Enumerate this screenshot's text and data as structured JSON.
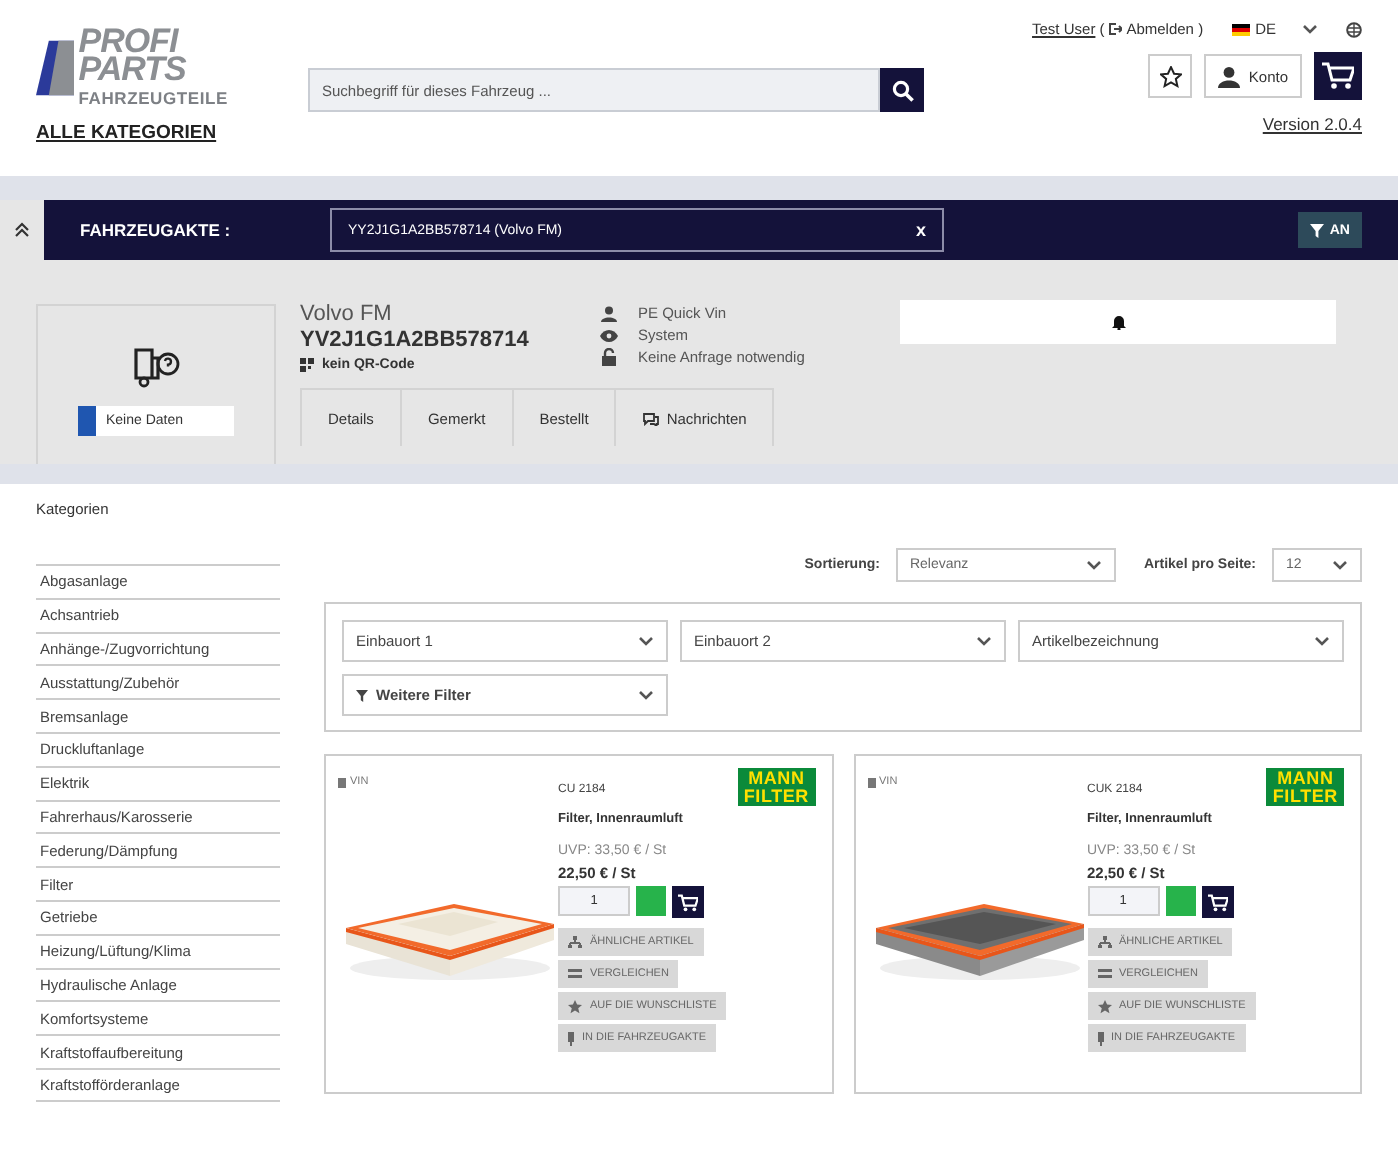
{
  "header": {
    "logo": {
      "line1": "PROFI",
      "line2": "PARTS",
      "tagline": "FAHRZEUGTEILE"
    },
    "all_categories": "ALLE KATEGORIEN",
    "search": {
      "placeholder": "Suchbegriff für dieses Fahrzeug ..."
    },
    "user": "Test User",
    "logout": {
      "open": "(",
      "label": "Abmelden",
      "close": ")"
    },
    "language": "DE",
    "account": "Konto",
    "version": "Version 2.0.4"
  },
  "vehicle_bar": {
    "label": "FAHRZEUGAKTE :",
    "value": "YY2J1G1A2BB578714 (Volvo FM)",
    "clear": "x",
    "filter_button": "AN"
  },
  "vehicle": {
    "image_status": "Keine Daten",
    "model": "Volvo FM",
    "vin": "YV2J1G1A2BB578714",
    "qr": "kein QR-Code",
    "info": [
      {
        "kind": "user",
        "text": "PE Quick Vin"
      },
      {
        "kind": "eye",
        "text": "System"
      },
      {
        "kind": "lock",
        "text": "Keine Anfrage notwendig"
      }
    ],
    "tabs": [
      {
        "kind": "plain",
        "label": "Details"
      },
      {
        "kind": "plain",
        "label": "Gemerkt"
      },
      {
        "kind": "plain",
        "label": "Bestellt"
      },
      {
        "kind": "chat",
        "label": "Nachrichten"
      }
    ]
  },
  "sidebar": {
    "title": "Kategorien",
    "items": [
      "Abgasanlage",
      "Achsantrieb",
      "Anhänge-/Zugvorrichtung",
      "Ausstattung/Zubehör",
      "Bremsanlage",
      "Druckluftanlage",
      "Elektrik",
      "Fahrerhaus/Karosserie",
      "Federung/Dämpfung",
      "Filter",
      "Getriebe",
      "Heizung/Lüftung/Klima",
      "Hydraulische Anlage",
      "Komfortsysteme",
      "Kraftstoffaufbereitung",
      "Kraftstofförderanlage"
    ]
  },
  "toolbar": {
    "sort_label": "Sortierung:",
    "sort_value": "Relevanz",
    "per_page_label": "Artikel pro Seite:",
    "per_page_value": "12"
  },
  "filters": [
    {
      "label": "Einbauort 1"
    },
    {
      "label": "Einbauort 2"
    },
    {
      "label": "Artikelbezeichnung"
    },
    {
      "label": "Weitere Filter",
      "kind": "more"
    }
  ],
  "products": [
    {
      "vin": "VIN",
      "code": "CU 2184",
      "name": "Filter, Innenraumluft",
      "uvp": "UVP: 33,50 € / St",
      "price": "22,50 € / St",
      "quantity": "1",
      "brand": [
        "MANN",
        "FILTER"
      ],
      "image": {
        "kind": "picture"
      },
      "actions": [
        {
          "kind": "similar",
          "label": "ÄHNLICHE ARTIKEL"
        },
        {
          "kind": "compare",
          "label": "VERGLEICHEN"
        },
        {
          "kind": "star",
          "label": "AUF DIE WUNSCHLISTE"
        },
        {
          "kind": "pin",
          "label": "IN DIE FAHRZEUGAKTE"
        }
      ]
    },
    {
      "vin": "VIN",
      "code": "CUK 2184",
      "name": "Filter, Innenraumluft",
      "uvp": "UVP: 33,50 € / St",
      "price": "22,50 € / St",
      "quantity": "1",
      "brand": [
        "MANN",
        "FILTER"
      ],
      "image": {
        "kind": "picture"
      },
      "actions": [
        {
          "kind": "similar",
          "label": "ÄHNLICHE ARTIKEL"
        },
        {
          "kind": "compare",
          "label": "VERGLEICHEN"
        },
        {
          "kind": "star",
          "label": "AUF DIE WUNSCHLISTE"
        },
        {
          "kind": "pin",
          "label": "IN DIE FAHRZEUGAKTE"
        }
      ]
    }
  ]
}
